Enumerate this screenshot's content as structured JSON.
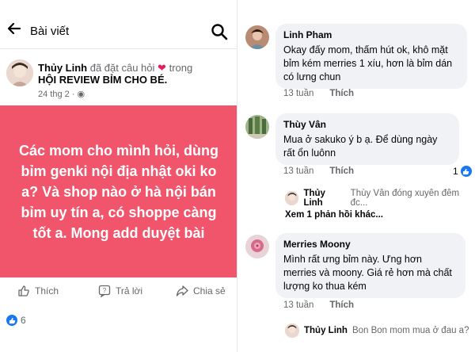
{
  "header": {
    "title": "Bài viết"
  },
  "post": {
    "author": "Thủy Linh",
    "action_text": "đã đặt câu hỏi",
    "in_text": "trong",
    "group": "HỘI REVIEW BỈM CHO BÉ.",
    "date": "24 thg 2 · ",
    "body": "Các mom cho mình hỏi, dùng bỉm genki nội địa nhật oki ko a? Và shop nào ở hà nội bán bỉm uy tín a, có shoppe càng tốt a. Mong add duyệt bài",
    "card_color": "#f0556c",
    "like_label": "Thích",
    "reply_label": "Trả lời",
    "share_label": "Chia sẻ",
    "reaction_count": "6"
  },
  "comments": [
    {
      "name": "Linh Pham",
      "text": "Okay đấy mom, thấm hút ok, khô mặt bỉm kém merries 1 xíu, hơn là bỉm dán có lưng chun",
      "time": "13 tuần",
      "like": "Thích"
    },
    {
      "name": "Thùy Vân",
      "text": "Mua ở sakuko ý b ạ. Để dùng ngày rất ổn luônn",
      "time": "13 tuần",
      "like": "Thích",
      "like_count": "1",
      "reply_preview": {
        "name": "Thủy Linh",
        "text": "Thùy Vân đóng xuyên đêm đc..."
      },
      "more_replies": "Xem 1 phản hồi khác..."
    },
    {
      "name": "Merries Moony",
      "text": "Mình rất ưng bỉm này. Ưng hơn merries và moony. Giá rẻ hơn mà chất lượng ko thua kém",
      "time": "13 tuần",
      "like": "Thích",
      "reply_preview": {
        "name": "Thủy Linh",
        "text": "Bon Bon mom mua ở đau a?"
      }
    }
  ]
}
